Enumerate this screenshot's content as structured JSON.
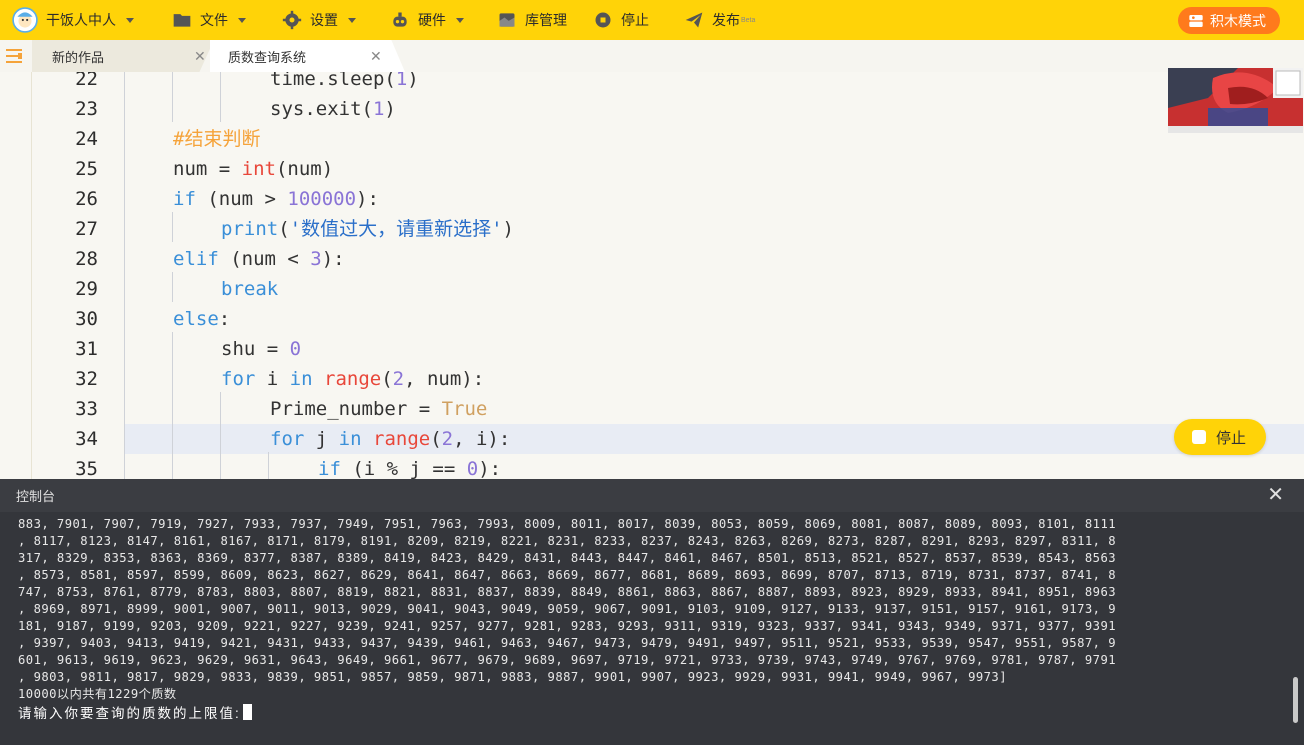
{
  "toolbar": {
    "user": "干饭人中人",
    "file": "文件",
    "settings": "设置",
    "hardware": "硬件",
    "library": "库管理",
    "stop": "停止",
    "publish": "发布",
    "publish_badge": "Beta",
    "block_mode": "积木模式"
  },
  "tabs": [
    {
      "label": "新的作品"
    },
    {
      "label": "质数查询系统"
    }
  ],
  "editor": {
    "line_numbers": [
      "22",
      "23",
      "24",
      "25",
      "26",
      "27",
      "28",
      "29",
      "30",
      "31",
      "32",
      "33",
      "34",
      "35"
    ]
  },
  "floating_stop": "停止",
  "console": {
    "title": "控制台",
    "output": "883, 7901, 7907, 7919, 7927, 7933, 7937, 7949, 7951, 7963, 7993, 8009, 8011, 8017, 8039, 8053, 8059, 8069, 8081, 8087, 8089, 8093, 8101, 8111\n, 8117, 8123, 8147, 8161, 8167, 8171, 8179, 8191, 8209, 8219, 8221, 8231, 8233, 8237, 8243, 8263, 8269, 8273, 8287, 8291, 8293, 8297, 8311, 8\n317, 8329, 8353, 8363, 8369, 8377, 8387, 8389, 8419, 8423, 8429, 8431, 8443, 8447, 8461, 8467, 8501, 8513, 8521, 8527, 8537, 8539, 8543, 8563\n, 8573, 8581, 8597, 8599, 8609, 8623, 8627, 8629, 8641, 8647, 8663, 8669, 8677, 8681, 8689, 8693, 8699, 8707, 8713, 8719, 8731, 8737, 8741, 8\n747, 8753, 8761, 8779, 8783, 8803, 8807, 8819, 8821, 8831, 8837, 8839, 8849, 8861, 8863, 8867, 8887, 8893, 8923, 8929, 8933, 8941, 8951, 8963\n, 8969, 8971, 8999, 9001, 9007, 9011, 9013, 9029, 9041, 9043, 9049, 9059, 9067, 9091, 9103, 9109, 9127, 9133, 9137, 9151, 9157, 9161, 9173, 9\n181, 9187, 9199, 9203, 9209, 9221, 9227, 9239, 9241, 9257, 9277, 9281, 9283, 9293, 9311, 9319, 9323, 9337, 9341, 9343, 9349, 9371, 9377, 9391\n, 9397, 9403, 9413, 9419, 9421, 9431, 9433, 9437, 9439, 9461, 9463, 9467, 9473, 9479, 9491, 9497, 9511, 9521, 9533, 9539, 9547, 9551, 9587, 9\n601, 9613, 9619, 9623, 9629, 9631, 9643, 9649, 9661, 9677, 9679, 9689, 9697, 9719, 9721, 9733, 9739, 9743, 9749, 9767, 9769, 9781, 9787, 9791\n, 9803, 9811, 9817, 9829, 9833, 9839, 9851, 9857, 9859, 9871, 9883, 9887, 9901, 9907, 9923, 9929, 9931, 9941, 9949, 9967, 9973]\n10000以内共有1229个质数",
    "prompt": "请输入你要查询的质数的上限值:"
  }
}
